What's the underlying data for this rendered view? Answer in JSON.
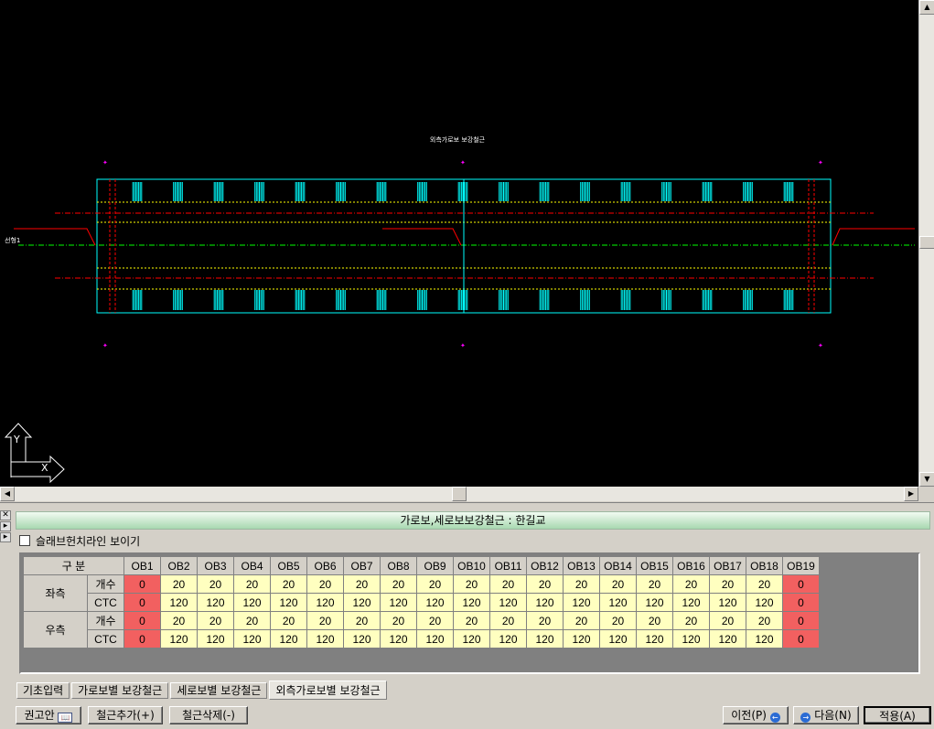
{
  "cad": {
    "drawing_title": "외측가로보 보강철근",
    "station_label": "선형1",
    "axis_labels": {
      "y": "Y",
      "x": "X"
    }
  },
  "panel": {
    "title": "가로보,세로보보강철근 : 한길교",
    "checkbox_label": "슬래브헌치라인 보이기",
    "checkbox_checked": false
  },
  "table": {
    "corner_header": "구 분",
    "columns": [
      "OB1",
      "OB2",
      "OB3",
      "OB4",
      "OB5",
      "OB6",
      "OB7",
      "OB8",
      "OB9",
      "OB10",
      "OB11",
      "OB12",
      "OB13",
      "OB14",
      "OB15",
      "OB16",
      "OB17",
      "OB18",
      "OB19"
    ],
    "groups": [
      {
        "label": "좌측",
        "rows": [
          {
            "label": "개수",
            "values": [
              "0",
              "20",
              "20",
              "20",
              "20",
              "20",
              "20",
              "20",
              "20",
              "20",
              "20",
              "20",
              "20",
              "20",
              "20",
              "20",
              "20",
              "20",
              "0"
            ]
          },
          {
            "label": "CTC",
            "values": [
              "0",
              "120",
              "120",
              "120",
              "120",
              "120",
              "120",
              "120",
              "120",
              "120",
              "120",
              "120",
              "120",
              "120",
              "120",
              "120",
              "120",
              "120",
              "0"
            ]
          }
        ]
      },
      {
        "label": "우측",
        "rows": [
          {
            "label": "개수",
            "values": [
              "0",
              "20",
              "20",
              "20",
              "20",
              "20",
              "20",
              "20",
              "20",
              "20",
              "20",
              "20",
              "20",
              "20",
              "20",
              "20",
              "20",
              "20",
              "0"
            ]
          },
          {
            "label": "CTC",
            "values": [
              "0",
              "120",
              "120",
              "120",
              "120",
              "120",
              "120",
              "120",
              "120",
              "120",
              "120",
              "120",
              "120",
              "120",
              "120",
              "120",
              "120",
              "120",
              "0"
            ]
          }
        ]
      }
    ]
  },
  "tabs": [
    {
      "label": "기초입력",
      "active": false
    },
    {
      "label": "가로보별 보강철근",
      "active": false
    },
    {
      "label": "세로보별 보강철근",
      "active": false
    },
    {
      "label": "외측가로보별 보강철근",
      "active": true
    }
  ],
  "buttons": {
    "recommend": "권고안",
    "add_rebar": "철근추가(+)",
    "delete_rebar": "철근삭제(-)",
    "prev": "이전(P)",
    "next": "다음(N)",
    "apply": "적용(A)"
  },
  "colors": {
    "cell_value": "#ffffc0",
    "cell_zero": "#f26060",
    "cad_outline": "#00ffff",
    "cad_yellow": "#ffff00",
    "cad_red": "#ff0000",
    "cad_green": "#00ff00",
    "cad_magenta": "#ff00ff"
  }
}
